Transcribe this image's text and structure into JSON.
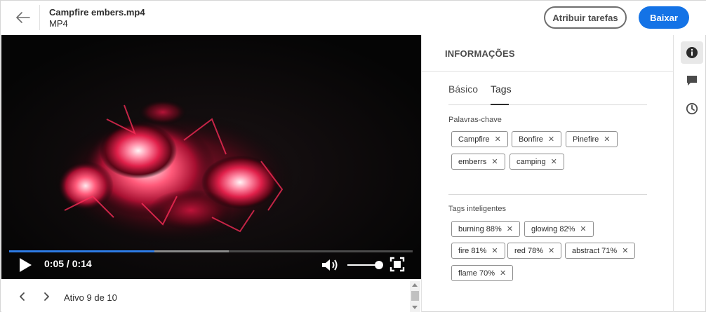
{
  "header": {
    "file_name": "Campfire embers.mp4",
    "file_type": "MP4",
    "assign_tasks_label": "Atribuir tarefas",
    "download_label": "Baixar",
    "back_icon": "arrow-left-icon"
  },
  "player": {
    "time_display": "0:05 / 0:14",
    "progress_fraction": 0.36,
    "buffered_fraction": 0.545,
    "volume_fraction": 0.9,
    "accent_color": "#2d7be5"
  },
  "navigation": {
    "asset_position": "Ativo 9 de 10"
  },
  "panel": {
    "title": "INFORMAÇÕES",
    "tabs": [
      {
        "label": "Básico"
      },
      {
        "label": "Tags"
      }
    ],
    "active_tab": "Tags",
    "keywords_label": "Palavras-chave",
    "keywords": [
      "Campfire",
      "Bonfire",
      "Pinefire",
      "emberrs",
      "camping"
    ],
    "smart_tags_label": "Tags inteligentes",
    "smart_tags": [
      "burning 88%",
      "glowing 82%",
      "fire 81%",
      "red 78%",
      "abstract 71%",
      "flame 70%"
    ]
  },
  "rail": {
    "items": [
      "info-icon",
      "comment-icon",
      "clock-icon"
    ]
  },
  "colors": {
    "primary": "#1473e6",
    "border": "#8e8e8e"
  }
}
